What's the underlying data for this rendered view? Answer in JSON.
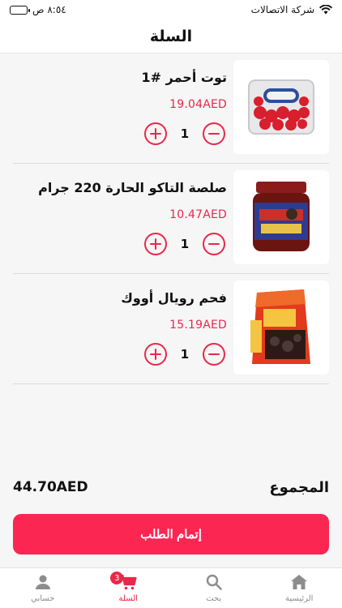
{
  "status_bar": {
    "carrier": "شركة الاتصالات",
    "time": "٨:٥٤ ص"
  },
  "header": {
    "title": "السلة"
  },
  "cart": {
    "items": [
      {
        "name": "توت أحمر #1",
        "price": "19.04AED",
        "quantity": "1",
        "image": "raspberries-pack"
      },
      {
        "name": "صلصة التاكو الحارة 220 جرام",
        "price": "10.47AED",
        "quantity": "1",
        "image": "taco-sauce-jar"
      },
      {
        "name": "فحم رويال أووك",
        "price": "15.19AED",
        "quantity": "1",
        "image": "charcoal-bag"
      }
    ]
  },
  "total": {
    "label": "المجموع",
    "value": "44.70AED"
  },
  "checkout": {
    "label": "إتمام الطلب"
  },
  "tab_bar": {
    "tabs": [
      {
        "label": "حسابي",
        "icon": "person-icon",
        "active": false
      },
      {
        "label": "السلة",
        "icon": "cart-icon",
        "active": true,
        "badge": "3"
      },
      {
        "label": "بحث",
        "icon": "search-icon",
        "active": false
      },
      {
        "label": "الرئيسية",
        "icon": "home-icon",
        "active": false
      }
    ]
  },
  "colors": {
    "accent": "#e8284a",
    "checkout_bg": "#fb2651",
    "background": "#f6f6f6"
  }
}
